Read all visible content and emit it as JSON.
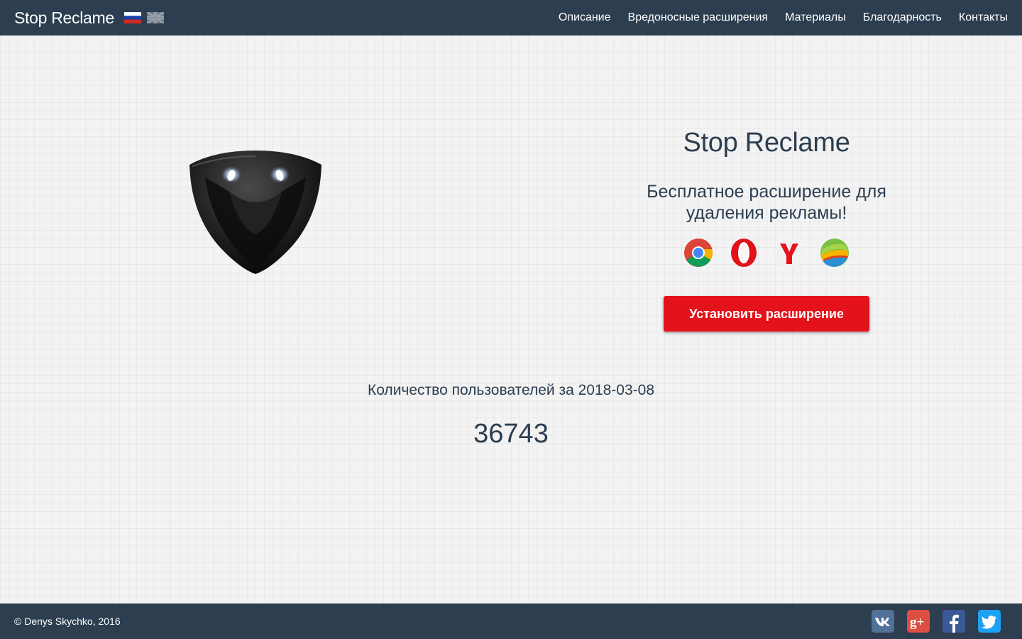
{
  "header": {
    "brand": "Stop Reclame",
    "flags": [
      "russian-flag-icon",
      "uk-flag-icon"
    ],
    "nav": [
      {
        "label": "Описание"
      },
      {
        "label": "Вредоносные расширения"
      },
      {
        "label": "Материалы"
      },
      {
        "label": "Благодарность"
      },
      {
        "label": "Контакты"
      }
    ]
  },
  "hero": {
    "logo_icon": "shield-mask-logo-icon",
    "title": "Stop Reclame",
    "subtitle": "Бесплатное расширение для удаления рекламы!",
    "browsers": [
      "chrome-icon",
      "opera-icon",
      "yandex-browser-icon",
      "bluestacks-icon"
    ],
    "install_label": "Установить расширение"
  },
  "stats": {
    "label": "Количество пользователей за 2018-03-08",
    "count": "36743"
  },
  "footer": {
    "copyright": "© Denys Skychko, 2016",
    "socials": [
      "vk-icon",
      "google-plus-icon",
      "facebook-icon",
      "twitter-icon"
    ]
  },
  "colors": {
    "bar": "#2c3e50",
    "button": "#e4121a",
    "text": "#2c3e50",
    "background": "#f3f3f3"
  }
}
